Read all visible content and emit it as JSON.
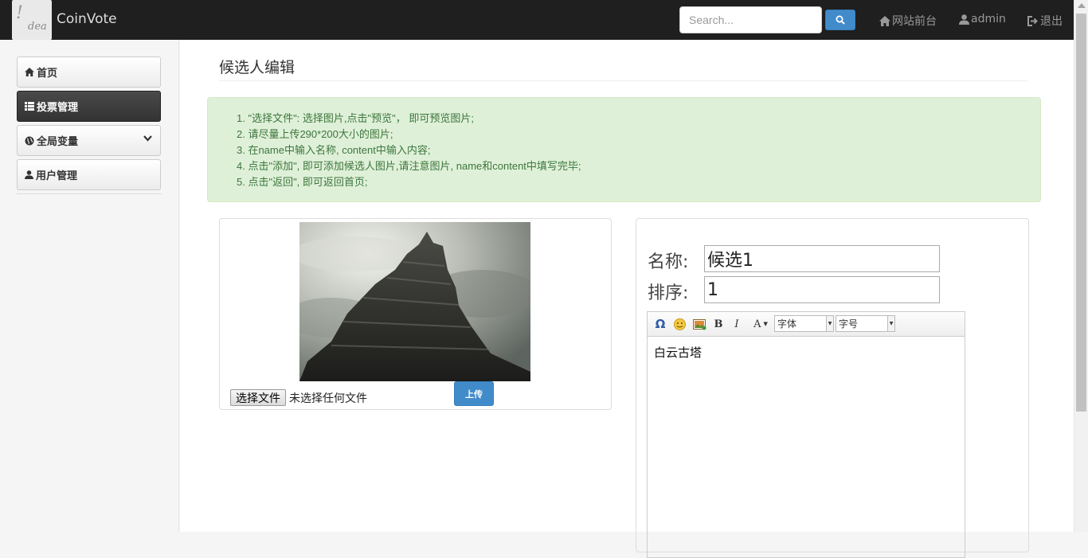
{
  "navbar": {
    "logo_text": "!",
    "logo_sub": "dea",
    "brand": "CoinVote",
    "search": {
      "placeholder": "Search..."
    },
    "links": [
      {
        "label": "网站前台",
        "icon": "home-icon"
      },
      {
        "label": "admin",
        "icon": "user-icon"
      },
      {
        "label": "退出",
        "icon": "logout-icon"
      }
    ]
  },
  "sidebar": {
    "items": [
      {
        "label": "首页",
        "icon": "home-icon"
      },
      {
        "label": "投票管理",
        "icon": "list-icon",
        "active": true
      },
      {
        "label": "全局变量",
        "icon": "globe-icon",
        "expandable": true
      },
      {
        "label": "用户管理",
        "icon": "user-icon"
      }
    ]
  },
  "main": {
    "title": "候选人编辑",
    "instructions": [
      "1.  \"选择文件\": 选择图片,点击\"预览\"， 即可预览图片;",
      "2.  请尽量上传290*200大小的图片;",
      "3.  在name中输入名称, content中输入内容;",
      "4.  点击\"添加\", 即可添加候选人图片,请注意图片, name和content中填写完毕;",
      "5.  点击\"返回\", 即可返回首页;"
    ],
    "upload": {
      "file_button": "选择文件",
      "file_status": "未选择任何文件",
      "upload_button": "上传"
    },
    "form": {
      "name_label": "名称:",
      "name_value": "候选1",
      "order_label": "排序:",
      "order_value": "1"
    },
    "editor": {
      "font_select": "字体",
      "size_select": "字号",
      "content": "白云古塔"
    }
  },
  "colors": {
    "navbar_bg": "#1f1f1f",
    "primary": "#428bca",
    "alert_bg": "#dff0d8",
    "alert_text": "#3c763d"
  }
}
